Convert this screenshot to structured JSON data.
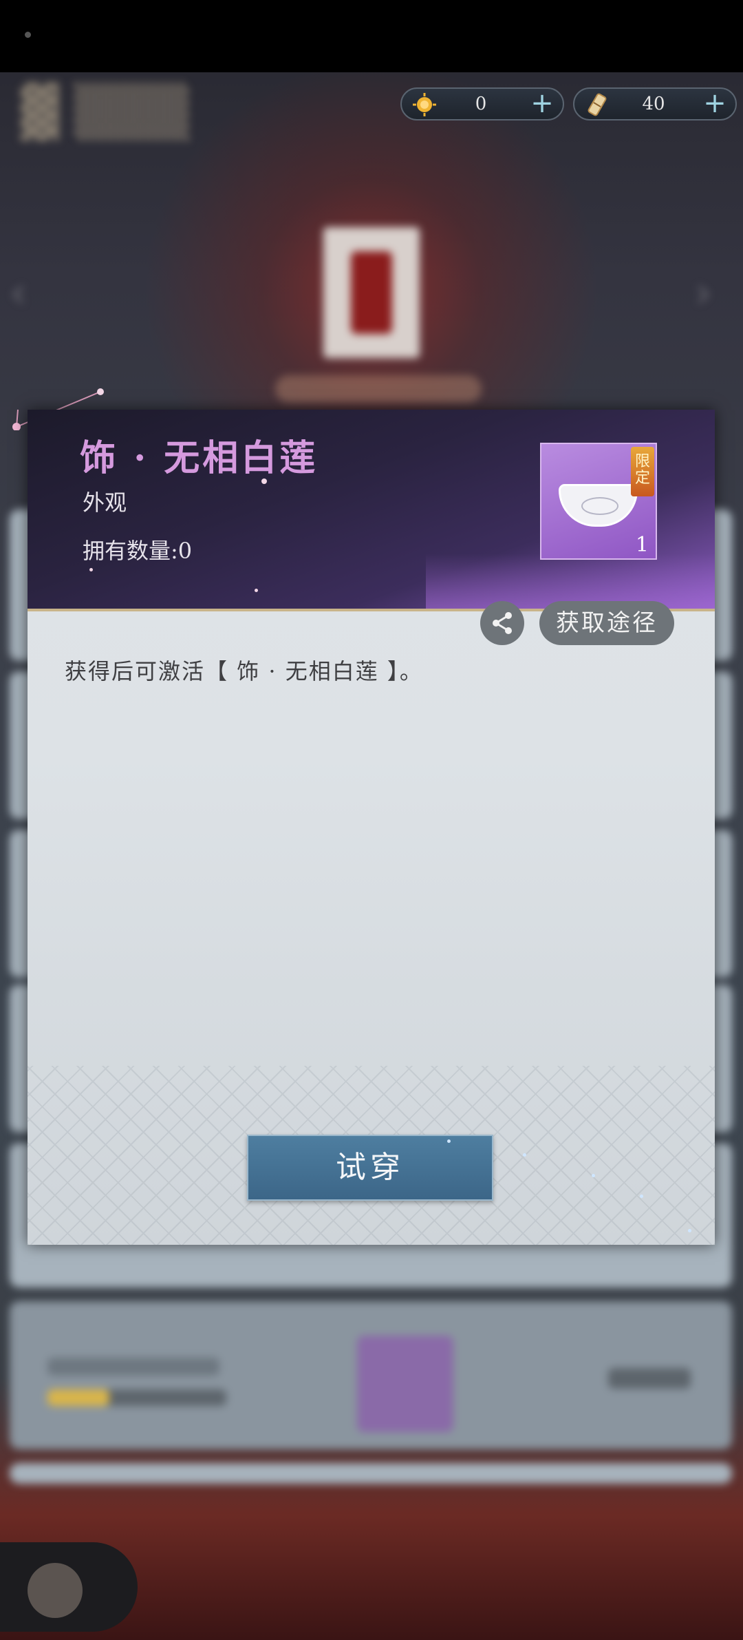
{
  "currency": [
    {
      "icon": "sun-coin-icon",
      "value": "0",
      "plus": "+"
    },
    {
      "icon": "scroll-ticket-icon",
      "value": "40",
      "plus": "+"
    }
  ],
  "item": {
    "title": "饰 · 无相白莲",
    "type": "外观",
    "owned": "拥有数量:0",
    "limited_badge": "限定",
    "thumb_count": "1",
    "description": "获得后可激活【 饰 · 无相白莲 】。"
  },
  "actions": {
    "share_icon": "share-icon",
    "source_label": "获取途径",
    "try_on_label": "试穿"
  },
  "colors": {
    "title": "#d59ade",
    "header_bg": "#2a2340",
    "try_button": "#4e7ea0"
  }
}
